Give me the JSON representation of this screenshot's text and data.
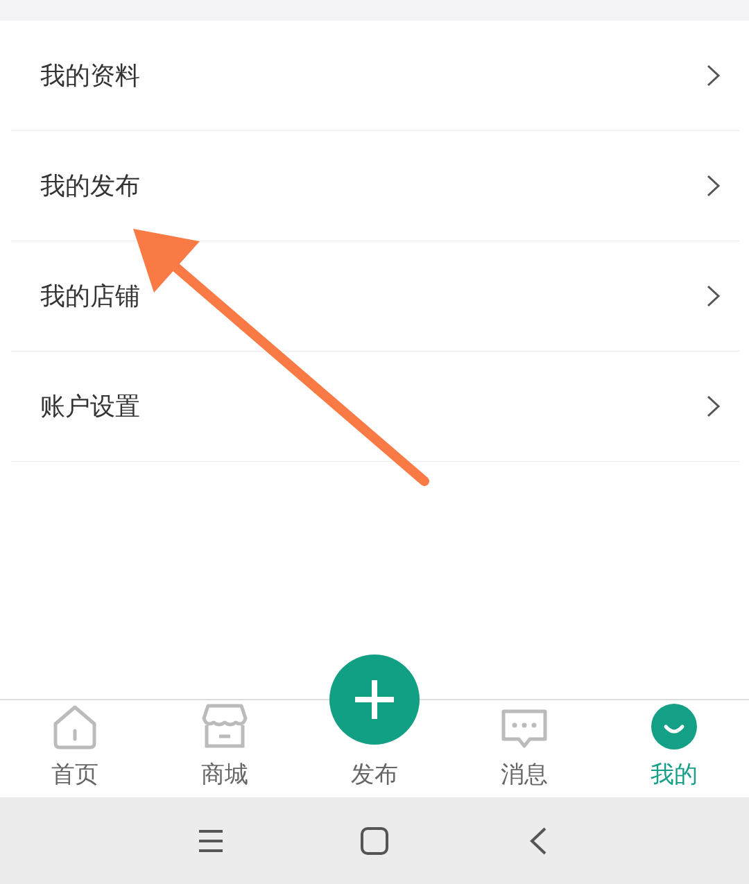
{
  "menu": [
    {
      "label": "我的资料"
    },
    {
      "label": "我的发布"
    },
    {
      "label": "我的店铺"
    },
    {
      "label": "账户设置"
    }
  ],
  "annotation": {
    "kind": "arrow"
  },
  "tabs": [
    {
      "label": "首页",
      "kind": "home",
      "selected": false
    },
    {
      "label": "商城",
      "kind": "store",
      "selected": false
    },
    {
      "label": "发布",
      "kind": "publish",
      "selected": false
    },
    {
      "label": "消息",
      "kind": "message",
      "selected": false
    },
    {
      "label": "我的",
      "kind": "profile",
      "selected": true
    }
  ],
  "system_nav": [
    {
      "kind": "menu"
    },
    {
      "kind": "home"
    },
    {
      "kind": "back"
    }
  ]
}
